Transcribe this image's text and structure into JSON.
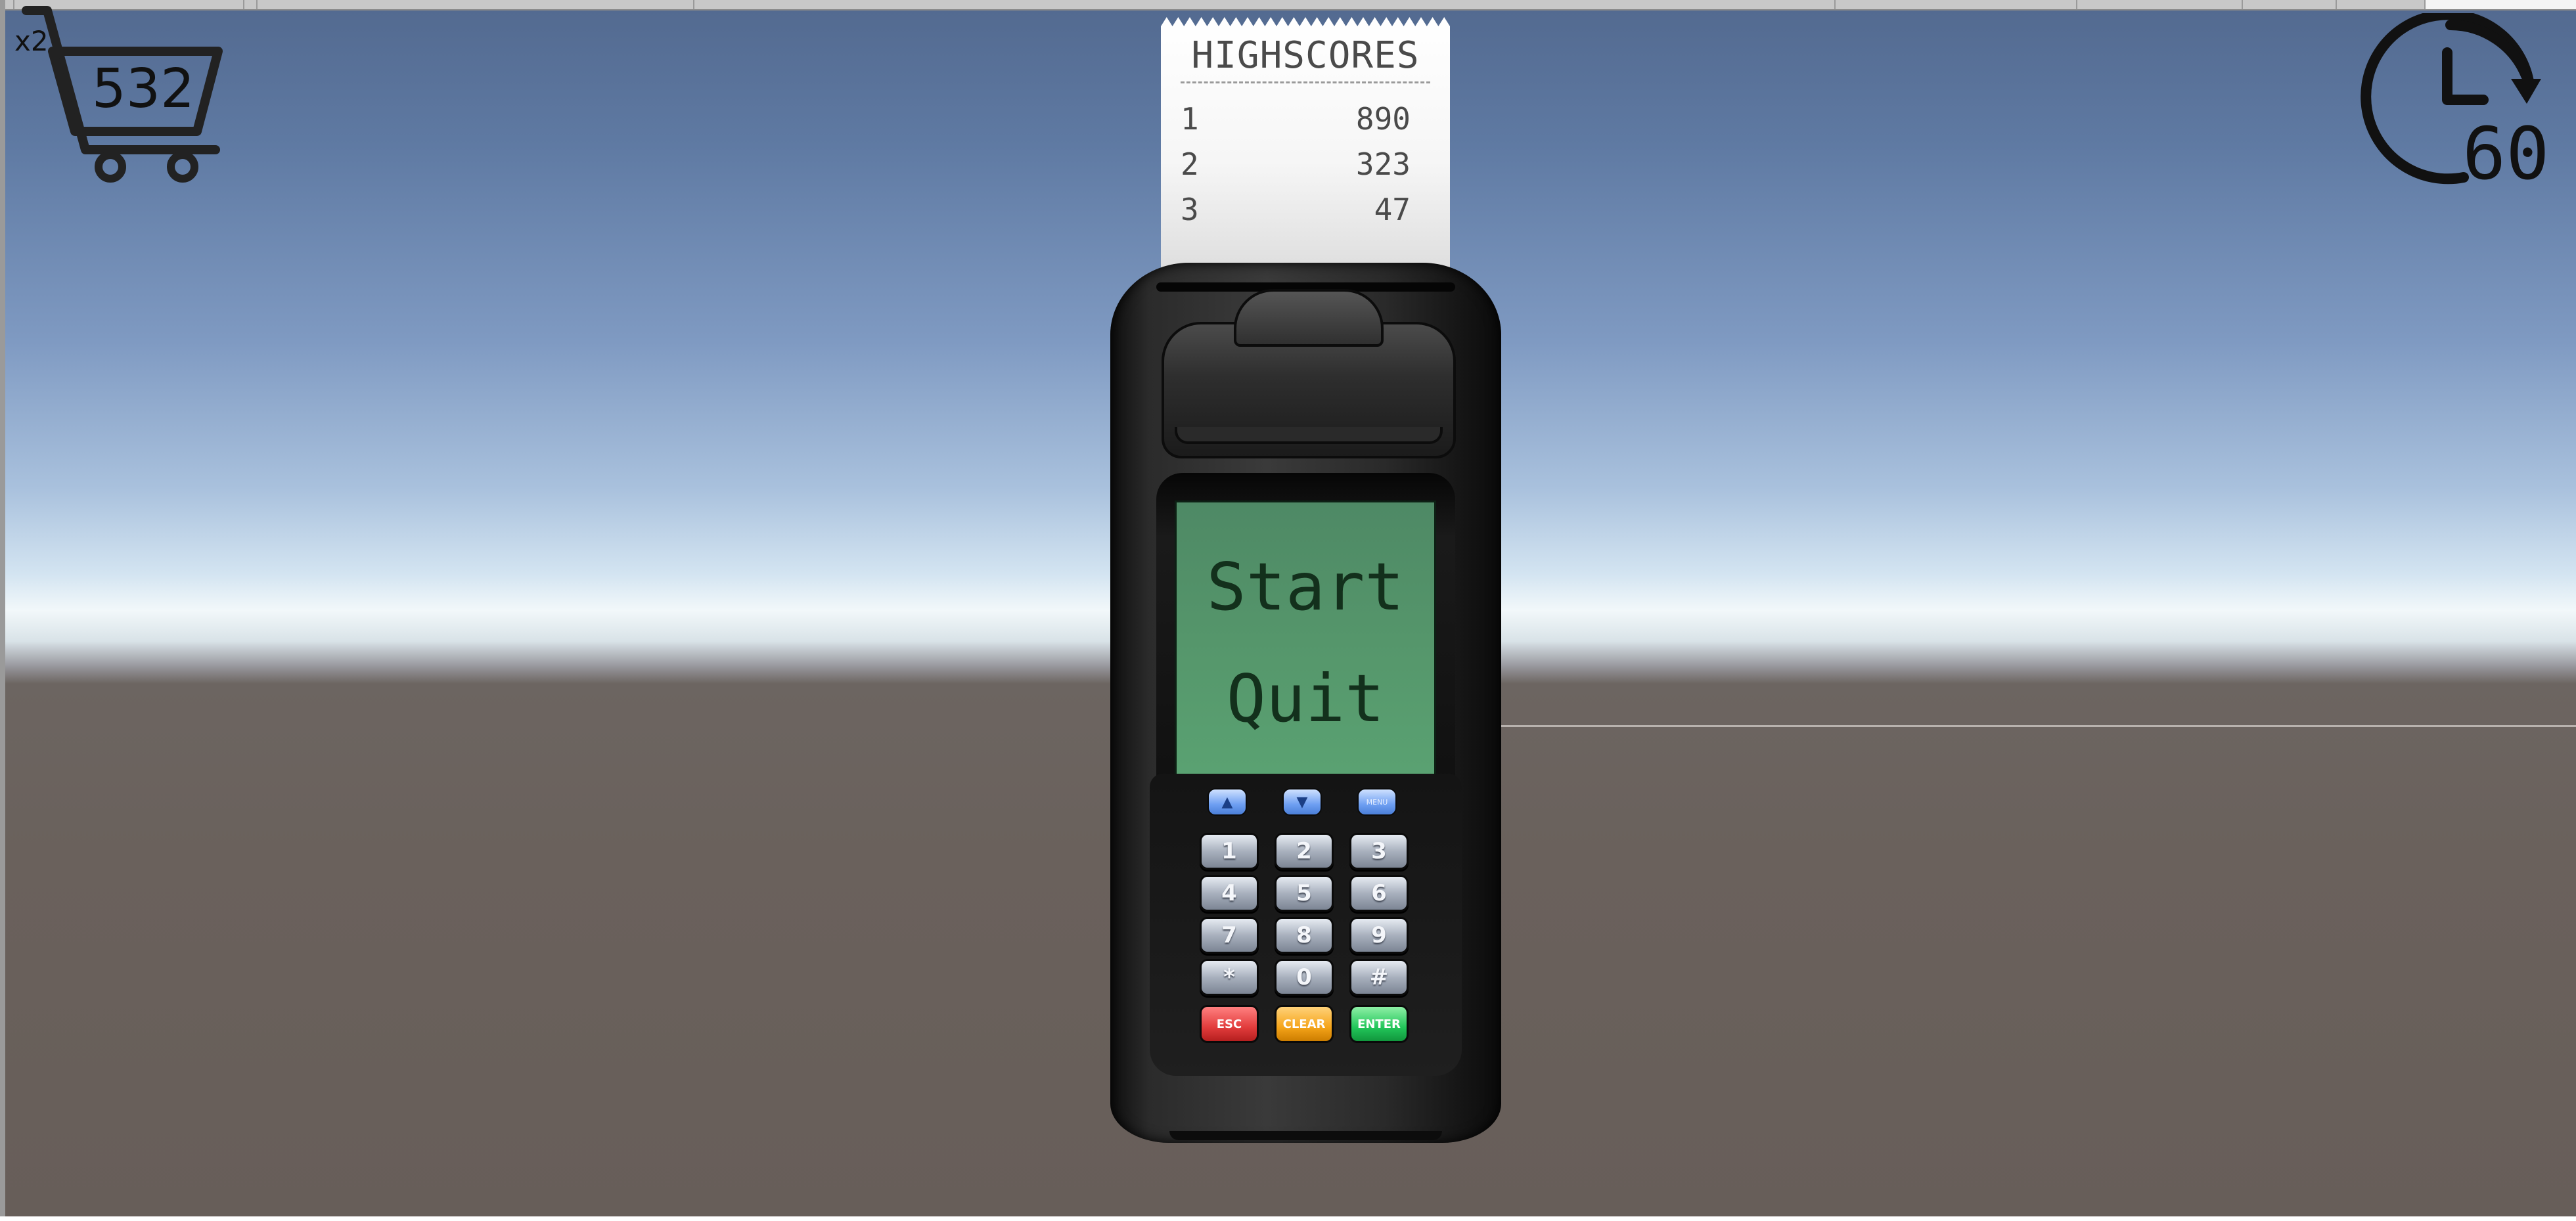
{
  "hud": {
    "multiplier": "x2",
    "cart_score": "532",
    "timer": "60",
    "icons": {
      "cart": "shopping-cart-icon",
      "timer": "clock-icon"
    }
  },
  "receipt": {
    "title": "HIGHSCORES",
    "scores": [
      {
        "rank": "1",
        "score": "890"
      },
      {
        "rank": "2",
        "score": "323"
      },
      {
        "rank": "3",
        "score": "47"
      }
    ]
  },
  "menu": {
    "start": "Start",
    "quit": "Quit"
  },
  "keypad": {
    "nav": [
      {
        "icon": "up-arrow-icon"
      },
      {
        "icon": "down-arrow-icon"
      },
      {
        "label": "MENU"
      }
    ],
    "keys": [
      "1",
      "2",
      "3",
      "4",
      "5",
      "6",
      "7",
      "8",
      "9",
      "*",
      "0",
      "#"
    ],
    "esc": "ESC",
    "clear": "CLEAR",
    "enter": "ENTER"
  },
  "colors": {
    "lcd": "#55966b",
    "lcd_text": "#13301c",
    "esc": "#e23c3c",
    "clear": "#f5a419",
    "enter": "#22c65a",
    "nav_keys": "#6e9ff2"
  }
}
